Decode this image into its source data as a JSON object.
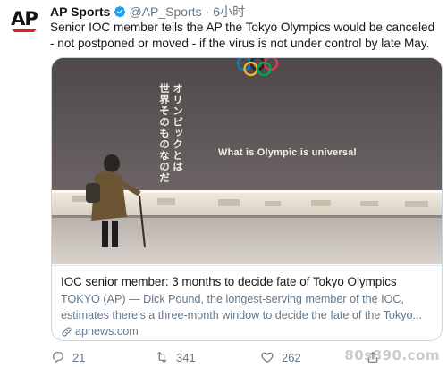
{
  "tweet": {
    "avatar_text": "AP",
    "display_name": "AP Sports",
    "handle": "@AP_Sports",
    "separator": "·",
    "time": "6小时",
    "text": "Senior IOC member tells the AP the Tokyo Olympics would be canceled - not postponed or moved - if the virus is not under control by late May."
  },
  "card": {
    "image": {
      "jp_col1": "オリンピックとは",
      "jp_col2": "世界そのものなのだ",
      "caption": "What is Olympic is universal"
    },
    "title": "IOC senior member: 3 months to decide fate of Tokyo Olympics",
    "description_line1": "TOKYO (AP) — Dick Pound, the longest-serving member of the IOC,",
    "description_line2": "estimates there's a three-month window to decide the fate of the Tokyo...",
    "domain": "apnews.com"
  },
  "actions": {
    "replies": "21",
    "retweets": "341",
    "likes": "262"
  },
  "watermark": "80s890.com",
  "colors": {
    "accent_verified": "#1da1f2",
    "ap_red": "#e0201c",
    "muted_text": "#657786"
  }
}
